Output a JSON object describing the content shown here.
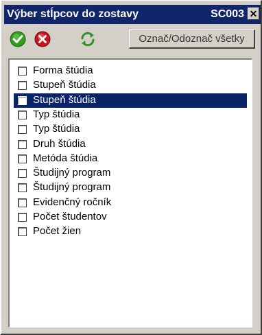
{
  "window": {
    "title": "Výber stĺpcov do zostavy",
    "code": "SC003",
    "close_label": "✕"
  },
  "toolbar": {
    "confirm_icon": "check-circle-icon",
    "cancel_icon": "cancel-circle-icon",
    "refresh_icon": "refresh-icon",
    "mark_all_label": "Označ/Odoznač všetky"
  },
  "columns": {
    "items": [
      {
        "label": "Forma štúdia",
        "checked": false
      },
      {
        "label": "Stupeň štúdia",
        "checked": false
      },
      {
        "label": "Stupeň štúdia",
        "checked": false,
        "selected": true
      },
      {
        "label": "Typ štúdia",
        "checked": false
      },
      {
        "label": "Typ štúdia",
        "checked": false
      },
      {
        "label": "Druh štúdia",
        "checked": false
      },
      {
        "label": "Metóda štúdia",
        "checked": false
      },
      {
        "label": "Študijný program",
        "checked": false
      },
      {
        "label": "Študijný program",
        "checked": false
      },
      {
        "label": "Evidenčný ročník",
        "checked": false
      },
      {
        "label": "Počet študentov",
        "checked": false
      },
      {
        "label": "Počet žien",
        "checked": false
      }
    ]
  },
  "colors": {
    "titlebar": "#11266a",
    "selection": "#0a246a",
    "confirm": "#2e9e1f",
    "cancel": "#c8141e",
    "refresh": "#2f8f2a"
  }
}
